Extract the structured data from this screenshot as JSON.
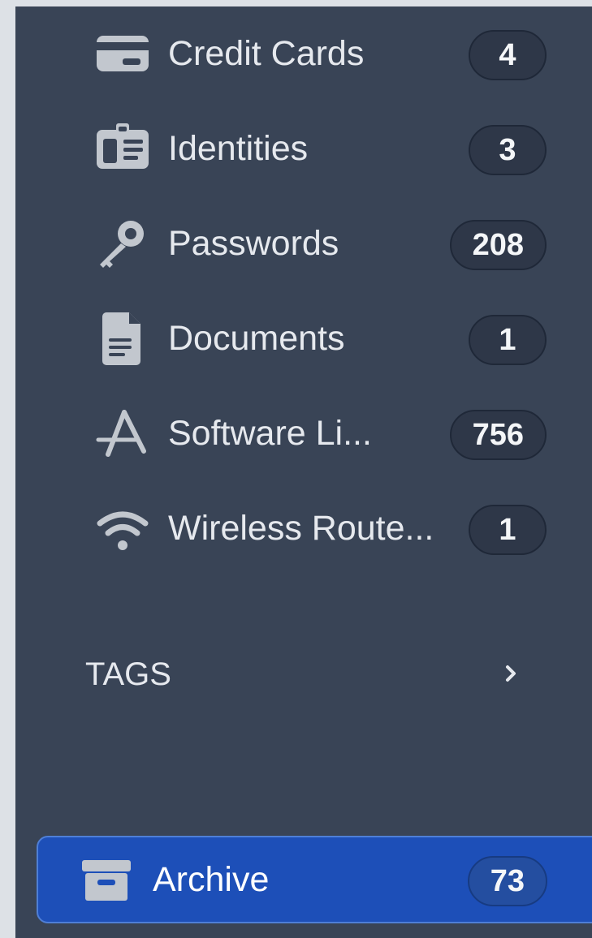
{
  "sidebar": {
    "categories": [
      {
        "label": "Credit Cards",
        "count": "4",
        "icon": "credit-card-icon"
      },
      {
        "label": "Identities",
        "count": "3",
        "icon": "identity-card-icon"
      },
      {
        "label": "Passwords",
        "count": "208",
        "icon": "key-icon"
      },
      {
        "label": "Documents",
        "count": "1",
        "icon": "document-icon"
      },
      {
        "label": "Software Li...",
        "count": "756",
        "icon": "app-store-icon"
      },
      {
        "label": "Wireless Route...",
        "count": "1",
        "icon": "wifi-icon"
      }
    ],
    "tags": {
      "title": "TAGS",
      "icon": "chevron-right-icon"
    },
    "archive": {
      "label": "Archive",
      "count": "73",
      "icon": "archive-box-icon",
      "selected": true
    }
  },
  "colors": {
    "page_background": "#dde1e6",
    "sidebar_background": "#394456",
    "badge_background": "#2e3748",
    "text": "#e6e9ee",
    "icon": "#c2c7ce",
    "selected_background": "#1d4fb8",
    "selected_border": "#4f7fd6"
  }
}
